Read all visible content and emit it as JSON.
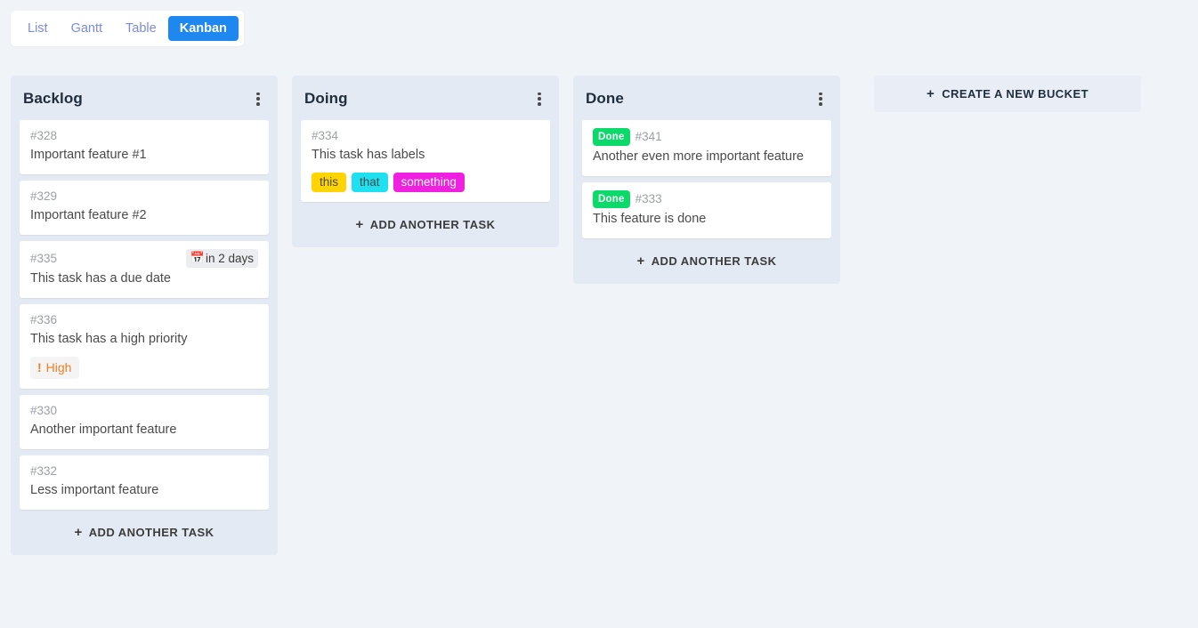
{
  "view_switcher": {
    "tabs": [
      {
        "label": "List",
        "active": false
      },
      {
        "label": "Gantt",
        "active": false
      },
      {
        "label": "Table",
        "active": false
      },
      {
        "label": "Kanban",
        "active": true
      }
    ]
  },
  "colors": {
    "page_background": "#f0f3f7",
    "bucket_background": "#e3eaf3",
    "card_background": "#ffffff",
    "active_tab": "#1e87f0",
    "inactive_tab_text": "#7c8cda",
    "done_badge": "#0bd96a",
    "priority_high_text": "#ef7f24"
  },
  "board": {
    "buckets": [
      {
        "title": "Backlog",
        "menu_icon": "dots-vertical-icon",
        "add_task_label": "Add another task",
        "tasks": [
          {
            "id": "#328",
            "title": "Important feature #1",
            "done": false,
            "due_date": null,
            "priority": null,
            "labels": []
          },
          {
            "id": "#329",
            "title": "Important feature #2",
            "done": false,
            "due_date": null,
            "priority": null,
            "labels": []
          },
          {
            "id": "#335",
            "title": "This task has a due date",
            "done": false,
            "due_date": "in 2 days",
            "due_icon": "calendar-icon",
            "priority": null,
            "labels": []
          },
          {
            "id": "#336",
            "title": "This task has a high priority",
            "done": false,
            "due_date": null,
            "priority": {
              "label": "High",
              "icon": "exclamation-icon"
            },
            "labels": []
          },
          {
            "id": "#330",
            "title": "Another important feature",
            "done": false,
            "due_date": null,
            "priority": null,
            "labels": []
          },
          {
            "id": "#332",
            "title": "Less important feature",
            "done": false,
            "due_date": null,
            "priority": null,
            "labels": []
          }
        ]
      },
      {
        "title": "Doing",
        "menu_icon": "dots-vertical-icon",
        "add_task_label": "Add another task",
        "tasks": [
          {
            "id": "#334",
            "title": "This task has labels",
            "done": false,
            "due_date": null,
            "priority": null,
            "labels": [
              {
                "text": "this",
                "background": "#ffd400",
                "color": "#4a4a4a"
              },
              {
                "text": "that",
                "background": "#1ee0f0",
                "color": "#4a4a4a"
              },
              {
                "text": "something",
                "background": "#f020e0",
                "color": "#ffffff"
              }
            ]
          }
        ]
      },
      {
        "title": "Done",
        "menu_icon": "dots-vertical-icon",
        "add_task_label": "Add another task",
        "tasks": [
          {
            "id": "#341",
            "title": "Another even more important feature",
            "done": true,
            "done_label": "Done",
            "due_date": null,
            "priority": null,
            "labels": []
          },
          {
            "id": "#333",
            "title": "This feature is done",
            "done": true,
            "done_label": "Done",
            "due_date": null,
            "priority": null,
            "labels": []
          }
        ]
      }
    ],
    "create_bucket_label": "Create a new bucket"
  }
}
